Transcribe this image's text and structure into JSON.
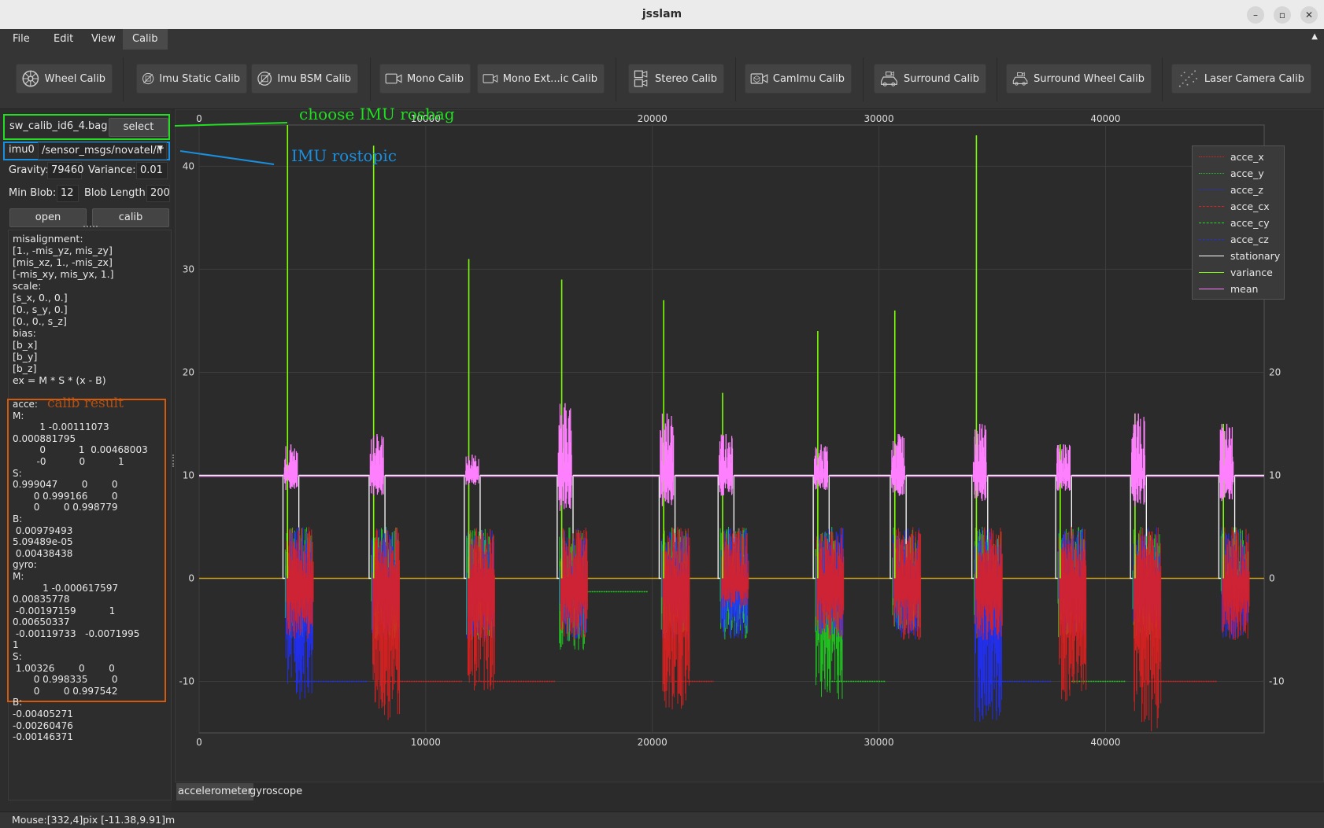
{
  "window": {
    "title": "jsslam"
  },
  "menu": [
    {
      "label": "File",
      "active": false
    },
    {
      "label": "Edit",
      "active": false
    },
    {
      "label": "View",
      "active": false
    },
    {
      "label": "Calib",
      "active": true
    }
  ],
  "toolbar": [
    {
      "label": "Wheel Calib",
      "icon": "wheel-icon"
    },
    {
      "label": "Imu Static Calib",
      "icon": "imu-static-icon"
    },
    {
      "label": "Imu BSM Calib",
      "icon": "imu-bsm-icon"
    },
    {
      "label": "Mono Calib",
      "icon": "camera-icon"
    },
    {
      "label": "Mono Ext...ic Calib",
      "icon": "camera-icon"
    },
    {
      "label": "Stereo Calib",
      "icon": "stereo-camera-icon"
    },
    {
      "label": "CamImu Calib",
      "icon": "camera-imu-icon"
    },
    {
      "label": "Surround Calib",
      "icon": "car-camera-icon"
    },
    {
      "label": "Surround Wheel Calib",
      "icon": "car-camera-icon"
    },
    {
      "label": "Laser Camera Calib",
      "icon": "laser-icon"
    }
  ],
  "left": {
    "bag_file": "sw_calib_id6_4.bag",
    "select_label": "select",
    "imu_label": "imu0",
    "topic": "/sensor_msgs/novatel/ir",
    "gravity_label": "Gravity:",
    "gravity_value": "79460",
    "variance_label": "Variance:",
    "variance_value": "0.01",
    "minblob_label": "Min Blob:",
    "minblob_value": "12",
    "bloblen_label": "Blob Length:",
    "bloblen_value": "200",
    "open_label": "open",
    "calib_label": "calib",
    "model_text": "misalignment:\n[1., -mis_yz, mis_zy]\n[mis_xz, 1., -mis_zx]\n[-mis_xy, mis_yx, 1.]\nscale:\n[s_x, 0., 0.]\n[0., s_y, 0.]\n[0., 0., s_z]\nbias:\n[b_x]\n[b_y]\n[b_z]\nex = M * S * (x - B)",
    "result_text": "acce:\nM:\n         1 -0.00111073\n0.000881795\n         0           1  0.00468003\n        -0           0           1\nS:\n0.999047        0        0\n       0 0.999166        0\n       0        0 0.998779\nB:\n 0.00979493\n5.09489e-05\n 0.00438438\ngyro:\nM:\n          1 -0.000617597\n0.00835778\n -0.00197159           1\n0.00650337\n -0.00119733   -0.0071995\n1\nS:\n 1.00326        0        0\n       0 0.998335        0\n       0        0 0.997542\nB:\n-0.00405271\n-0.00260476\n-0.00146371"
  },
  "annotations": {
    "rosbag": "choose  IMU  rosbag",
    "rostopic": "IMU  rostopic",
    "result": "calib  result",
    "rosbag_color": "#22dd22",
    "rostopic_color": "#1a8fe0",
    "result_color": "#d05a10"
  },
  "tabs": [
    {
      "label": "accelerometer",
      "active": true
    },
    {
      "label": "gyroscope",
      "active": false
    }
  ],
  "status": {
    "text": "Mouse:[332,4]pix [-11.38,9.91]m"
  },
  "chart_data": {
    "type": "line",
    "xlim": [
      0,
      47000
    ],
    "ylim": [
      -15,
      44
    ],
    "x_ticks": [
      0,
      10000,
      20000,
      30000,
      40000
    ],
    "y_ticks": [
      -10,
      0,
      10,
      20,
      30,
      40
    ],
    "grid": true,
    "legend": "top-right",
    "series": [
      {
        "name": "acce_x",
        "color": "#e02020"
      },
      {
        "name": "acce_y",
        "color": "#20c020"
      },
      {
        "name": "acce_z",
        "color": "#2030e0"
      },
      {
        "name": "acce_cx",
        "color": "#e02020"
      },
      {
        "name": "acce_cy",
        "color": "#20e020"
      },
      {
        "name": "acce_cz",
        "color": "#2030e0"
      },
      {
        "name": "stationary",
        "color": "#ffffff"
      },
      {
        "name": "variance",
        "color": "#7cff00"
      },
      {
        "name": "mean",
        "color": "#ff80ff"
      }
    ],
    "events": [
      {
        "x": 3900,
        "variance_peak": 44,
        "mean_peak": 13,
        "min": -12,
        "color": "blue"
      },
      {
        "x": 7700,
        "variance_peak": 42,
        "mean_peak": 14,
        "min": -14,
        "color": "red"
      },
      {
        "x": 11900,
        "variance_peak": 31,
        "mean_peak": 12,
        "min": -11,
        "color": "red"
      },
      {
        "x": 16000,
        "variance_peak": 29,
        "mean_peak": 17,
        "min": -7,
        "color": "green"
      },
      {
        "x": 20500,
        "variance_peak": 27,
        "mean_peak": 16,
        "min": -13,
        "color": "red"
      },
      {
        "x": 23100,
        "variance_peak": 18,
        "mean_peak": 14,
        "min": -3,
        "color": "red"
      },
      {
        "x": 27300,
        "variance_peak": 24,
        "mean_peak": 13,
        "min": -12,
        "color": "green"
      },
      {
        "x": 30700,
        "variance_peak": 26,
        "mean_peak": 14,
        "min": -5,
        "color": "green"
      },
      {
        "x": 34300,
        "variance_peak": 43,
        "mean_peak": 15,
        "min": -14,
        "color": "blue"
      },
      {
        "x": 38000,
        "variance_peak": 13,
        "mean_peak": 13,
        "min": -12,
        "color": "red"
      },
      {
        "x": 41300,
        "variance_peak": 16,
        "mean_peak": 16,
        "min": -15,
        "color": "red"
      },
      {
        "x": 45200,
        "variance_peak": 15,
        "mean_peak": 15,
        "min": -2,
        "color": "green"
      }
    ],
    "stationary_level": 10,
    "static_levels": [
      {
        "x1": 4200,
        "x2": 7400,
        "y": -10,
        "color": "blue"
      },
      {
        "x1": 8000,
        "x2": 11600,
        "y": -10,
        "color": "red"
      },
      {
        "x1": 12200,
        "x2": 15700,
        "y": -10,
        "color": "red"
      },
      {
        "x1": 16800,
        "x2": 19800,
        "y": -1.3,
        "color": "green"
      },
      {
        "x1": 21000,
        "x2": 22700,
        "y": -10,
        "color": "red"
      },
      {
        "x1": 27800,
        "x2": 30300,
        "y": -10,
        "color": "green"
      },
      {
        "x1": 34700,
        "x2": 37600,
        "y": -10,
        "color": "blue"
      },
      {
        "x1": 38500,
        "x2": 40900,
        "y": -10,
        "color": "green"
      },
      {
        "x1": 41700,
        "x2": 44900,
        "y": -10,
        "color": "red"
      }
    ]
  }
}
